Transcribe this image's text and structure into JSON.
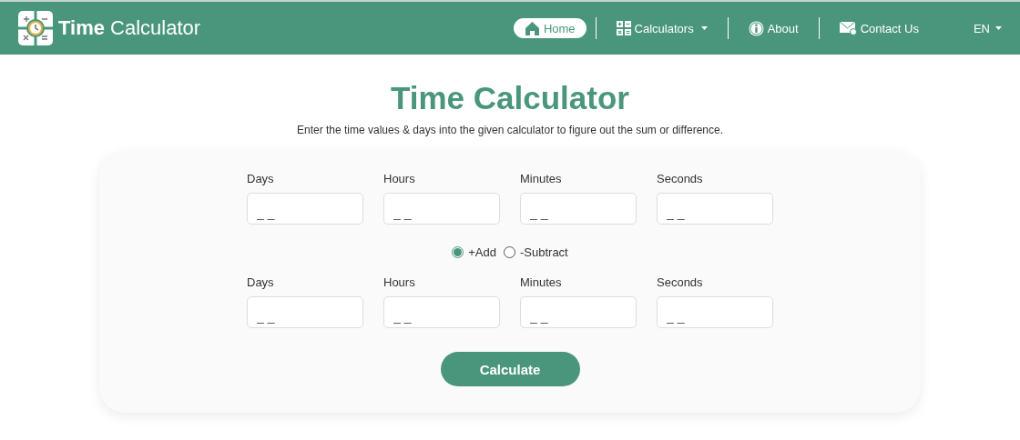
{
  "header": {
    "logo_bold": "Time",
    "logo_rest": "Calculator",
    "nav": [
      {
        "kind": "home",
        "label": "Home",
        "selected": true,
        "dropdown": false
      },
      {
        "kind": "calculator",
        "label": "Calculators",
        "selected": false,
        "dropdown": true
      },
      {
        "kind": "info",
        "label": "About",
        "selected": false,
        "dropdown": false
      },
      {
        "kind": "mail",
        "label": "Contact Us",
        "selected": false,
        "dropdown": false
      }
    ],
    "language": "EN"
  },
  "title": "Time Calculator",
  "subtitle": "Enter the time values & days into the given calculator to figure out the sum or difference.",
  "first_time": [
    {
      "label": "Days",
      "placeholder": "_ _"
    },
    {
      "label": "Hours",
      "placeholder": "_ _"
    },
    {
      "label": "Minutes",
      "placeholder": "_ _"
    },
    {
      "label": "Seconds",
      "placeholder": "_ _"
    }
  ],
  "operations": [
    {
      "label": "+Add",
      "selected": true
    },
    {
      "label": "-Subtract",
      "selected": false
    }
  ],
  "second_time": [
    {
      "label": "Days",
      "placeholder": "_ _"
    },
    {
      "label": "Hours",
      "placeholder": "_ _"
    },
    {
      "label": "Minutes",
      "placeholder": "_ _"
    },
    {
      "label": "Seconds",
      "placeholder": "_ _"
    }
  ],
  "button": "Calculate"
}
